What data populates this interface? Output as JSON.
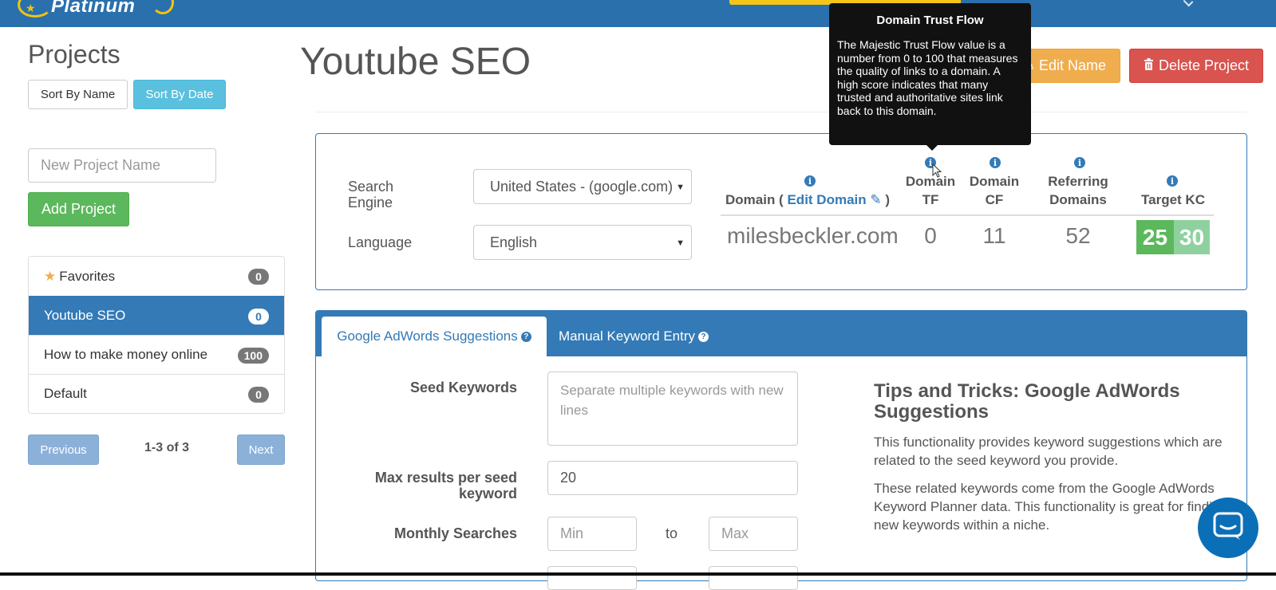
{
  "brand": {
    "logo_text": "Platinum"
  },
  "sidebar": {
    "title": "Projects",
    "sort_by_name": "Sort By Name",
    "sort_by_date": "Sort By Date",
    "new_project_placeholder": "New Project Name",
    "add_project": "Add Project",
    "items": [
      {
        "label": "Favorites",
        "count": "0",
        "starred": true,
        "active": false
      },
      {
        "label": "Youtube SEO",
        "count": "0",
        "active": true
      },
      {
        "label": "How to make money online",
        "count": "100",
        "active": false
      },
      {
        "label": "Default",
        "count": "0",
        "active": false
      }
    ],
    "pagination": {
      "previous": "Previous",
      "info": "1-3 of 3",
      "next": "Next"
    }
  },
  "project": {
    "title": "Youtube SEO",
    "edit_name": "Edit Name",
    "delete_project": "Delete Project"
  },
  "settings": {
    "search_engine_label": "Search Engine",
    "search_engine_value": "United States - (google.com)",
    "language_label": "Language",
    "language_value": "English"
  },
  "domain_table": {
    "headers": {
      "domain_prefix": "Domain (",
      "edit_domain": "Edit Domain",
      "domain_suffix": ")",
      "tf": "Domain TF",
      "cf": "Domain CF",
      "ref": "Referring Domains",
      "kc": "Target KC"
    },
    "row": {
      "domain": "milesbeckler.com",
      "tf": "0",
      "cf": "11",
      "ref": "52",
      "kc_low": "25",
      "kc_high": "30"
    }
  },
  "tooltip": {
    "title": "Domain Trust Flow",
    "body": "The Majestic Trust Flow value is a number from 0 to 100 that measures the quality of links to a domain. A high score indicates that many trusted and authoritative sites link back to this domain."
  },
  "tabs": [
    {
      "label": "Google AdWords Suggestions",
      "active": true
    },
    {
      "label": "Manual Keyword Entry",
      "active": false
    }
  ],
  "form": {
    "seed_label": "Seed Keywords",
    "seed_placeholder": "Separate multiple keywords with new lines",
    "max_label": "Max results per seed keyword",
    "max_value": "20",
    "monthly_label": "Monthly Searches",
    "min_placeholder": "Min",
    "to": "to",
    "max_placeholder": "Max"
  },
  "tips": {
    "title": "Tips and Tricks: Google AdWords Suggestions",
    "p1": "This functionality provides keyword suggestions which are related to the seed keyword you provide.",
    "p2": "These related keywords come from the Google AdWords Keyword Planner data. This functionality is great for finding new keywords within a niche."
  },
  "colors": {
    "topbar": "#2a70ad",
    "primary": "#337ab7",
    "success": "#5cb85c",
    "warning": "#f0ad4e",
    "danger": "#d9534f",
    "info": "#5bc0de"
  }
}
